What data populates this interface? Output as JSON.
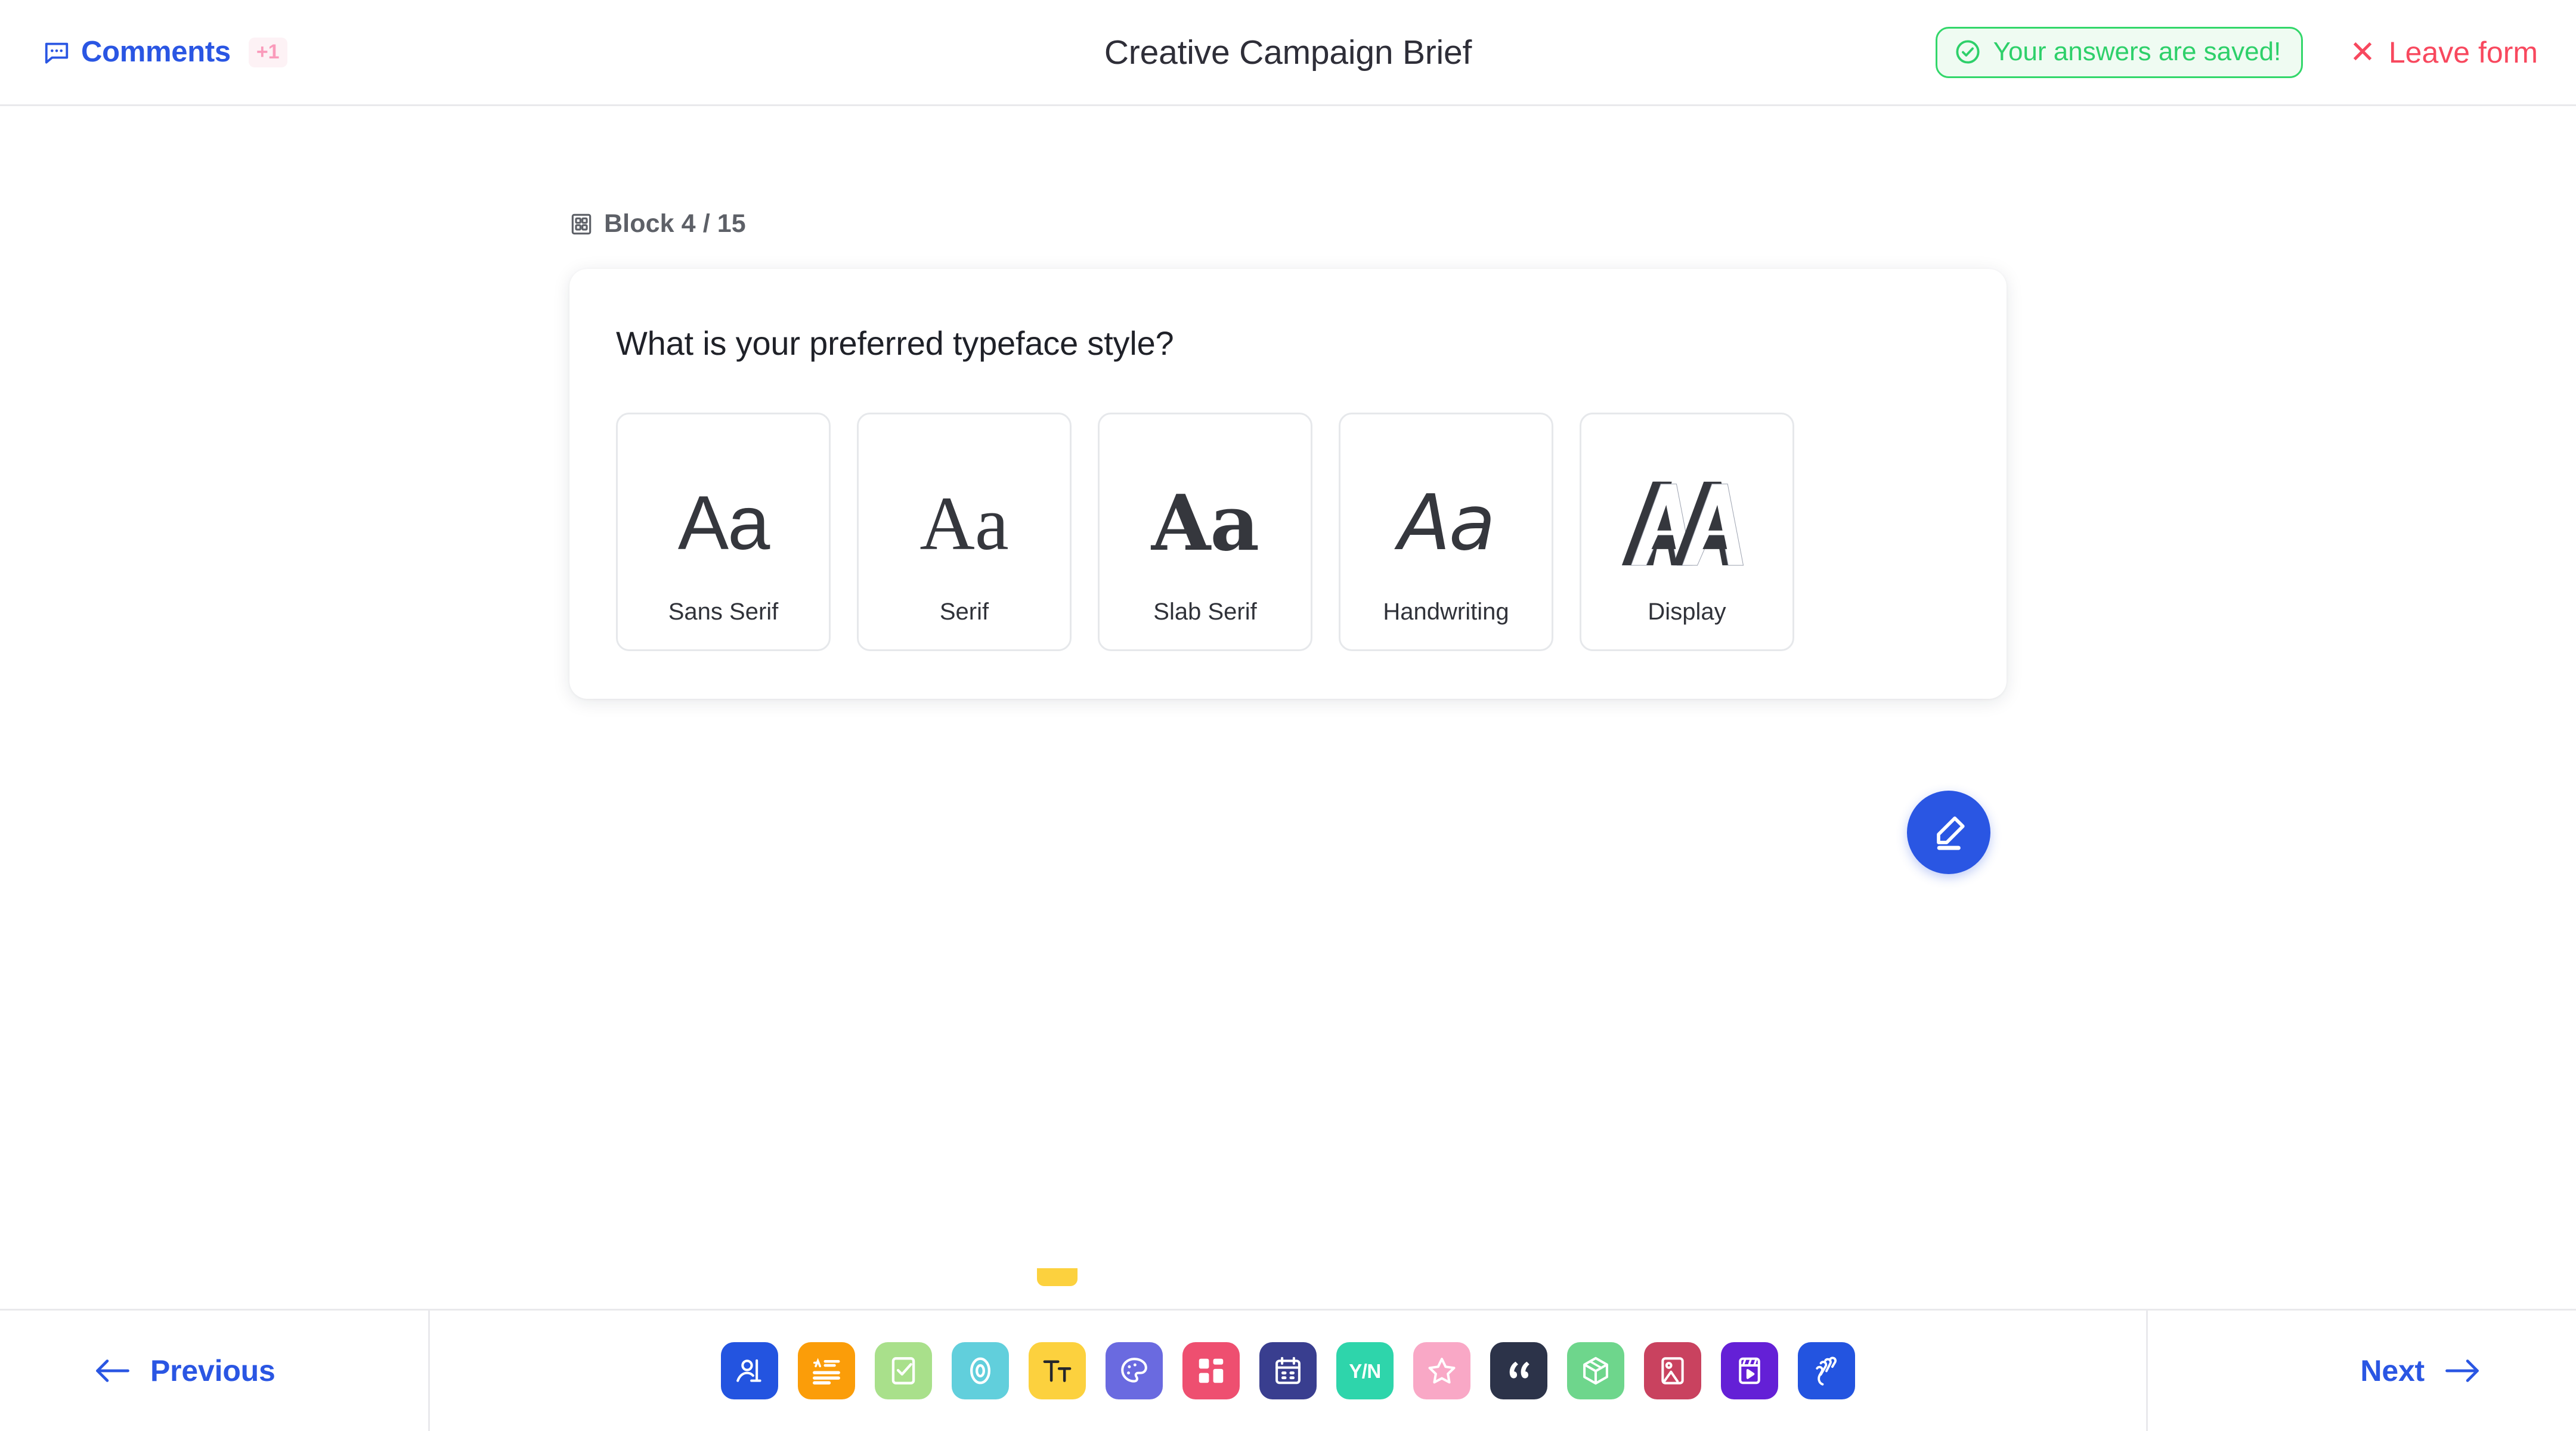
{
  "header": {
    "comments_label": "Comments",
    "comments_badge": "+1",
    "comments_icon": "comment-bubble-icon",
    "title": "Creative Campaign Brief",
    "saved_text": "Your answers are saved!",
    "saved_icon": "check-circle-icon",
    "saved_border_color": "#32d76a",
    "saved_bg_color": "#effbf2",
    "saved_text_color": "#2ed06a",
    "leave_x": "✕",
    "leave_label": "Leave form",
    "leave_color": "#f8485e",
    "accent_color": "#2a56e3"
  },
  "block": {
    "icon": "blocks-grid-icon",
    "label": "Block 4 / 15",
    "current": 4,
    "total": 15
  },
  "question": {
    "text": "What is your preferred typeface style?",
    "options": [
      {
        "label": "Sans Serif",
        "preview": "Aa",
        "style": "g-sans",
        "name": "option-sans-serif"
      },
      {
        "label": "Serif",
        "preview": "Aa",
        "style": "g-serif",
        "name": "option-serif"
      },
      {
        "label": "Slab Serif",
        "preview": "Aa",
        "style": "g-slab",
        "name": "option-slab-serif"
      },
      {
        "label": "Handwriting",
        "preview": "Aa",
        "style": "g-hand",
        "name": "option-handwriting"
      },
      {
        "label": "Display",
        "preview": "AA",
        "style": "g-display",
        "name": "option-display"
      }
    ]
  },
  "fab": {
    "icon": "edit-pencil-icon",
    "color": "#2a56e3"
  },
  "footer": {
    "previous_label": "Previous",
    "previous_icon": "arrow-left-icon",
    "next_label": "Next",
    "next_icon": "arrow-right-icon",
    "nav_color": "#2a56e3",
    "tools": [
      {
        "name": "tool-speaker",
        "icon": "person-presenter-icon",
        "color": "#2354e0",
        "active": false
      },
      {
        "name": "tool-long-text",
        "icon": "text-lines-icon",
        "color": "#fb9d09",
        "active": false
      },
      {
        "name": "tool-checklist",
        "icon": "checkbox-list-icon",
        "color": "#a9e08b",
        "active": false
      },
      {
        "name": "tool-target",
        "icon": "target-circle-icon",
        "color": "#61cfdc",
        "active": false
      },
      {
        "name": "tool-typography",
        "icon": "typography-tt-icon",
        "color": "#fcd13e",
        "active": true
      },
      {
        "name": "tool-palette",
        "icon": "color-palette-icon",
        "color": "#6a6ae0",
        "active": false
      },
      {
        "name": "tool-grid",
        "icon": "grid-blocks-icon",
        "color": "#ee4f70",
        "active": false
      },
      {
        "name": "tool-calendar",
        "icon": "calendar-icon",
        "color": "#393e8f",
        "active": false
      },
      {
        "name": "tool-yes-no",
        "icon": "yes-no-icon",
        "color": "#2ed5ab",
        "active": false
      },
      {
        "name": "tool-rating",
        "icon": "star-rating-icon",
        "color": "#f9a8c6",
        "active": false
      },
      {
        "name": "tool-quote",
        "icon": "quote-marks-icon",
        "color": "#2c3349",
        "active": false
      },
      {
        "name": "tool-product",
        "icon": "box-cube-icon",
        "color": "#6ed68c",
        "active": false
      },
      {
        "name": "tool-image",
        "icon": "image-picture-icon",
        "color": "#c9425f",
        "active": false
      },
      {
        "name": "tool-video",
        "icon": "video-clapper-icon",
        "color": "#6420d6",
        "active": false
      },
      {
        "name": "tool-thanks",
        "icon": "waving-hand-icon",
        "color": "#2354e0",
        "active": false
      }
    ]
  }
}
